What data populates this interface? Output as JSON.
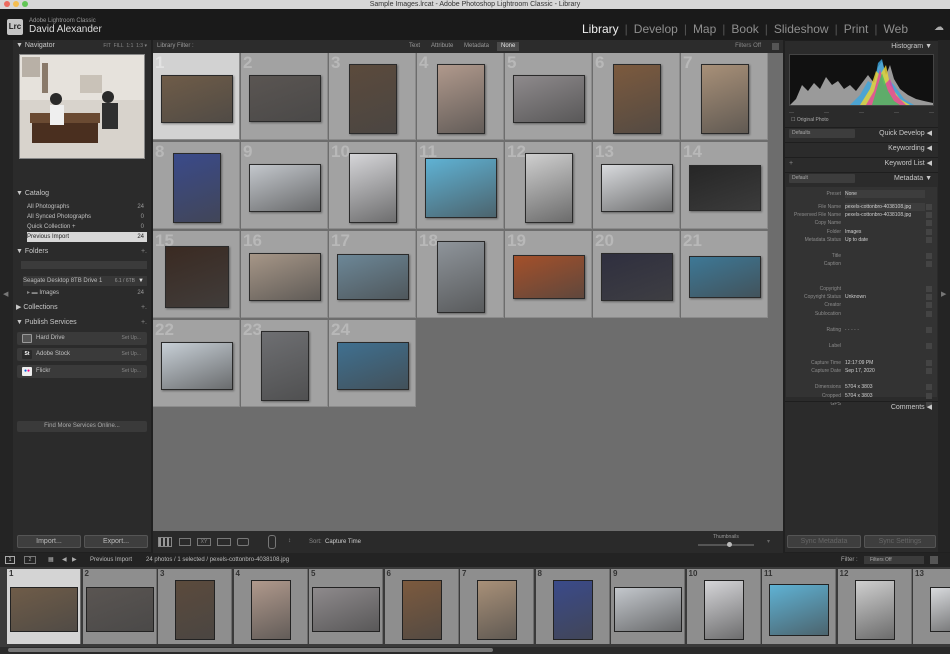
{
  "window": {
    "title": "Sample Images.lrcat - Adobe Photoshop Lightroom Classic - Library"
  },
  "identity": {
    "app": "Adobe Lightroom Classic",
    "user": "David Alexander",
    "logo": "Lrc"
  },
  "modules": [
    {
      "label": "Library",
      "active": true
    },
    {
      "label": "Develop"
    },
    {
      "label": "Map"
    },
    {
      "label": "Book"
    },
    {
      "label": "Slideshow"
    },
    {
      "label": "Print"
    },
    {
      "label": "Web"
    }
  ],
  "left_panel": {
    "navigator": {
      "title": "Navigator",
      "zoom_options": [
        "FIT",
        "FILL",
        "1:1",
        "1:3"
      ]
    },
    "catalog": {
      "title": "Catalog",
      "items": [
        {
          "label": "All Photographs",
          "count": "24"
        },
        {
          "label": "All Synced Photographs",
          "count": "0"
        },
        {
          "label": "Quick Collection +",
          "count": "0"
        },
        {
          "label": "Previous Import",
          "count": "24",
          "selected": true
        }
      ]
    },
    "folders": {
      "title": "Folders",
      "drive": {
        "label": "Seagate Desktop 8TB Drive 1",
        "capacity": "6.1 / 6TB"
      },
      "items": [
        {
          "label": "Images",
          "count": "24"
        }
      ]
    },
    "collections": {
      "title": "Collections"
    },
    "publish": {
      "title": "Publish Services",
      "items": [
        {
          "label": "Hard Drive",
          "action": "Set Up..."
        },
        {
          "label": "Adobe Stock",
          "action": "Set Up...",
          "badge": "St"
        },
        {
          "label": "Flickr",
          "action": "Set Up..."
        }
      ],
      "find_more": "Find More Services Online..."
    },
    "import_label": "Import...",
    "export_label": "Export..."
  },
  "filter_bar": {
    "title": "Library Filter :",
    "options": [
      "Text",
      "Attribute",
      "Metadata",
      "None"
    ],
    "active": "None",
    "filters_off": "Filters Off"
  },
  "grid": {
    "cells": [
      {
        "n": "1",
        "w": 72,
        "h": 48,
        "color": "#6f5c48",
        "selected": true
      },
      {
        "n": "2",
        "w": 72,
        "h": 47,
        "color": "#5a5552"
      },
      {
        "n": "3",
        "w": 48,
        "h": 70,
        "color": "#5b4a3c"
      },
      {
        "n": "4",
        "w": 48,
        "h": 70,
        "color": "#b0998c"
      },
      {
        "n": "5",
        "w": 72,
        "h": 48,
        "color": "#8e8a8c"
      },
      {
        "n": "6",
        "w": 48,
        "h": 70,
        "color": "#7c5a3e"
      },
      {
        "n": "7",
        "w": 48,
        "h": 70,
        "color": "#a89078"
      },
      {
        "n": "8",
        "w": 48,
        "h": 70,
        "color": "#3a4a8a"
      },
      {
        "n": "9",
        "w": 72,
        "h": 48,
        "color": "#c3c7cc"
      },
      {
        "n": "10",
        "w": 48,
        "h": 70,
        "color": "#d5d5d8"
      },
      {
        "n": "11",
        "w": 72,
        "h": 60,
        "color": "#5fb2d4"
      },
      {
        "n": "12",
        "w": 48,
        "h": 70,
        "color": "#cfcfcf"
      },
      {
        "n": "13",
        "w": 72,
        "h": 48,
        "color": "#d8dadd"
      },
      {
        "n": "14",
        "w": 72,
        "h": 46,
        "color": "#262626"
      },
      {
        "n": "15",
        "w": 64,
        "h": 62,
        "color": "#3a2a22"
      },
      {
        "n": "16",
        "w": 72,
        "h": 48,
        "color": "#a69687"
      },
      {
        "n": "17",
        "w": 72,
        "h": 46,
        "color": "#6c8797"
      },
      {
        "n": "18",
        "w": 48,
        "h": 72,
        "color": "#8e949a"
      },
      {
        "n": "19",
        "w": 72,
        "h": 44,
        "color": "#a4502a"
      },
      {
        "n": "20",
        "w": 72,
        "h": 48,
        "color": "#2f2f3f"
      },
      {
        "n": "21",
        "w": 72,
        "h": 42,
        "color": "#3d7896"
      },
      {
        "n": "22",
        "w": 72,
        "h": 48,
        "color": "#c7cfd6"
      },
      {
        "n": "23",
        "w": 48,
        "h": 70,
        "color": "#6e6f72"
      },
      {
        "n": "24",
        "w": 72,
        "h": 48,
        "color": "#3f7090"
      }
    ]
  },
  "toolbar": {
    "sort_label": "Sort:",
    "sort_value": "Capture Time",
    "thumbnails_label": "Thumbnails"
  },
  "right_panel": {
    "histogram": {
      "title": "Histogram",
      "original_photo": "Original Photo"
    },
    "quick_develop": {
      "preset": "Defaults",
      "title": "Quick Develop"
    },
    "keywording": {
      "title": "Keywording"
    },
    "keyword_list": {
      "title": "Keyword List"
    },
    "metadata": {
      "preset": "Default",
      "title": "Metadata",
      "preset_label": "Preset",
      "preset_value": "None",
      "rows": [
        {
          "k": "File Name",
          "v": "pexels-cottonbro-4038108.jpg",
          "box": true
        },
        {
          "k": "Preserved File Name",
          "v": "pexels-cottonbro-4038108.jpg"
        },
        {
          "k": "Copy Name",
          "v": "",
          "box": true
        },
        {
          "k": "Folder",
          "v": "Images"
        },
        {
          "k": "Metadata Status",
          "v": "Up to date"
        },
        {
          "k": "",
          "v": ""
        },
        {
          "k": "Title",
          "v": "",
          "box": true
        },
        {
          "k": "Caption",
          "v": "",
          "box": true
        },
        {
          "k": "",
          "v": ""
        },
        {
          "k": "",
          "v": ""
        },
        {
          "k": "Copyright",
          "v": "",
          "box": true
        },
        {
          "k": "Copyright Status",
          "v": "Unknown"
        },
        {
          "k": "Creator",
          "v": "",
          "box": true
        },
        {
          "k": "Sublocation",
          "v": "",
          "box": true
        },
        {
          "k": "",
          "v": ""
        },
        {
          "k": "Rating",
          "v": "· · · · ·"
        },
        {
          "k": "",
          "v": ""
        },
        {
          "k": "Label",
          "v": "",
          "box": true
        },
        {
          "k": "",
          "v": ""
        },
        {
          "k": "Capture Time",
          "v": "12:17:09 PM"
        },
        {
          "k": "Capture Date",
          "v": "Sep 17, 2020"
        },
        {
          "k": "",
          "v": ""
        },
        {
          "k": "Dimensions",
          "v": "5704 x 3803"
        },
        {
          "k": "Cropped",
          "v": "5704 x 3803"
        },
        {
          "k": "GPS",
          "v": ""
        }
      ]
    },
    "comments": {
      "title": "Comments"
    },
    "sync_metadata": "Sync Metadata",
    "sync_settings": "Sync Settings"
  },
  "filmstrip_bar": {
    "pages": [
      "1",
      "2"
    ],
    "source": "Previous Import",
    "summary": "24 photos / 1 selected / pexels-cottonbro-4038108.jpg",
    "filter_label": "Filter :",
    "filter_value": "Filters Off"
  },
  "filmstrip": {
    "cells": [
      {
        "n": "1",
        "color": "#6f5c48",
        "w": 68,
        "h": 45,
        "selected": true
      },
      {
        "n": "2",
        "color": "#5a5552",
        "w": 68,
        "h": 45
      },
      {
        "n": "3",
        "color": "#5b4a3c",
        "w": 40,
        "h": 60
      },
      {
        "n": "4",
        "color": "#b0998c",
        "w": 40,
        "h": 60
      },
      {
        "n": "5",
        "color": "#8e8a8c",
        "w": 68,
        "h": 45
      },
      {
        "n": "6",
        "color": "#7c5a3e",
        "w": 40,
        "h": 60
      },
      {
        "n": "7",
        "color": "#a89078",
        "w": 40,
        "h": 60
      },
      {
        "n": "8",
        "color": "#3a4a8a",
        "w": 40,
        "h": 60
      },
      {
        "n": "9",
        "color": "#c3c7cc",
        "w": 68,
        "h": 45
      },
      {
        "n": "10",
        "color": "#d5d5d8",
        "w": 40,
        "h": 60
      },
      {
        "n": "11",
        "color": "#5fb2d4",
        "w": 60,
        "h": 52
      },
      {
        "n": "12",
        "color": "#cfcfcf",
        "w": 40,
        "h": 60
      },
      {
        "n": "13",
        "color": "#d8dadd",
        "w": 40,
        "h": 45
      }
    ]
  }
}
